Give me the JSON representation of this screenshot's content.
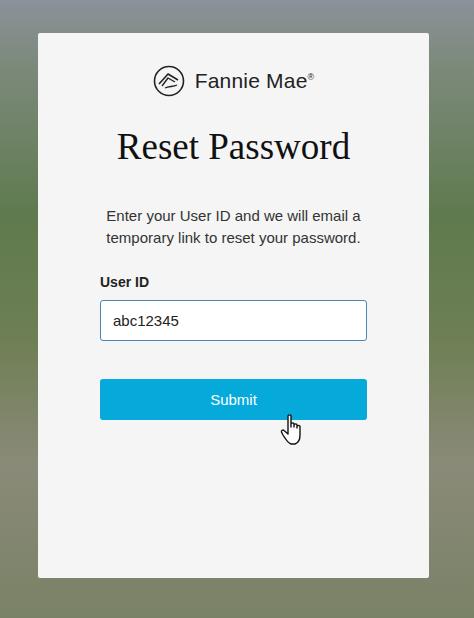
{
  "logo": {
    "name": "Fannie Mae",
    "mark": "®"
  },
  "title": "Reset Password",
  "description": "Enter your User ID and we will email a temporary link to reset your password.",
  "form": {
    "label": "User ID",
    "value": "abc12345"
  },
  "buttons": [
    {
      "label": "Submit",
      "hovered": true
    }
  ]
}
